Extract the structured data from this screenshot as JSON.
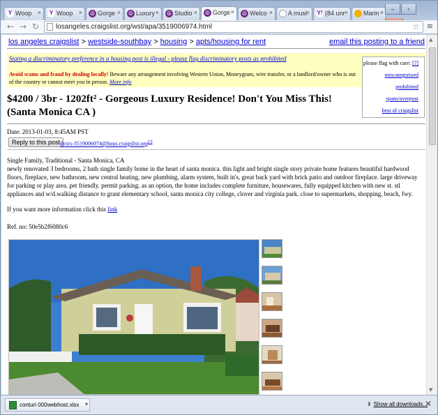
{
  "browser": {
    "tabs": [
      {
        "label": "Woop",
        "icon": "yahoo-icon"
      },
      {
        "label": "Woop",
        "icon": "yahoo-icon"
      },
      {
        "label": "Gorge",
        "icon": "craigslist-peace-icon"
      },
      {
        "label": "Luxury",
        "icon": "craigslist-peace-icon"
      },
      {
        "label": "Studio",
        "icon": "craigslist-peace-icon"
      },
      {
        "label": "Gorge",
        "icon": "craigslist-peace-icon"
      },
      {
        "label": "Welco",
        "icon": "craigslist-peace-icon"
      },
      {
        "label": "A musi",
        "icon": "page-icon"
      },
      {
        "label": "(84 unr",
        "icon": "yahoo-icon"
      },
      {
        "label": "Marin",
        "icon": "google-icon"
      }
    ],
    "url": "losangeles.craigslist.org/wst/apa/3519006974.html"
  },
  "breadcrumb": {
    "items": [
      "los angeles craigslist",
      "westside-southbay",
      "housing",
      "apts/housing for rent"
    ],
    "separator": ">"
  },
  "email_posting": "email this posting to a friend",
  "warning": {
    "discrimination": "Stating a discriminatory preference in a housing post is illegal - please flag discriminatory posts as prohibited",
    "scam_bold": "Avoid scams and fraud by dealing locally!",
    "scam_text": " Beware any arrangement involving Western Union, Moneygram, wire transfer, or a landlord/owner who is out of the country or cannot meet you in person.",
    "scam_link": "More info"
  },
  "flag": {
    "heading": "please flag with care:",
    "help": "[?]",
    "options": [
      "miscategorized",
      "prohibited",
      "spam/overpost",
      "best of craigslist"
    ]
  },
  "posting": {
    "title": "$4200 / 3br - 1202ft² - Gorgeous Luxury Residence! Don't You Miss This! (Santa Monica CA )",
    "date": "Date: 2013-01-03,  8:45AM PST",
    "reply_label": "Reply to this post",
    "reply_email": "dvstx-3519006974@hous.craigslist.org",
    "reply_sup": "[?]",
    "subtitle": "Single Family, Traditional - Santa Monica, CA",
    "description": "newly renovated 3 bedrooms, 2 bath single family home in the heart of santa monica. this light and bright single story private home features beautiful hardwood floors, fireplace, new bathroom, new central heating, new plumbing, alarm system, built in's, great back yard with brick patio and outdoor fireplace. large driveway for parking or play area. pet friendly. permit parking. as an option, the home includes complete furniture, housewares, fully equipped kitchen with new st. stl appliances and w/d.walking distance to grant elementary school, santa monica city college, clover and virginia park. close to supermarkets, shopping, beach, fwy.",
    "more_info_text": "If you want more information click this ",
    "more_info_link": "link",
    "ref": "Ref. no: 50e5b2f6080c6"
  },
  "downloads": {
    "file": "conturi 000webhost.xlsx",
    "show_all": "Show all downloads..."
  }
}
